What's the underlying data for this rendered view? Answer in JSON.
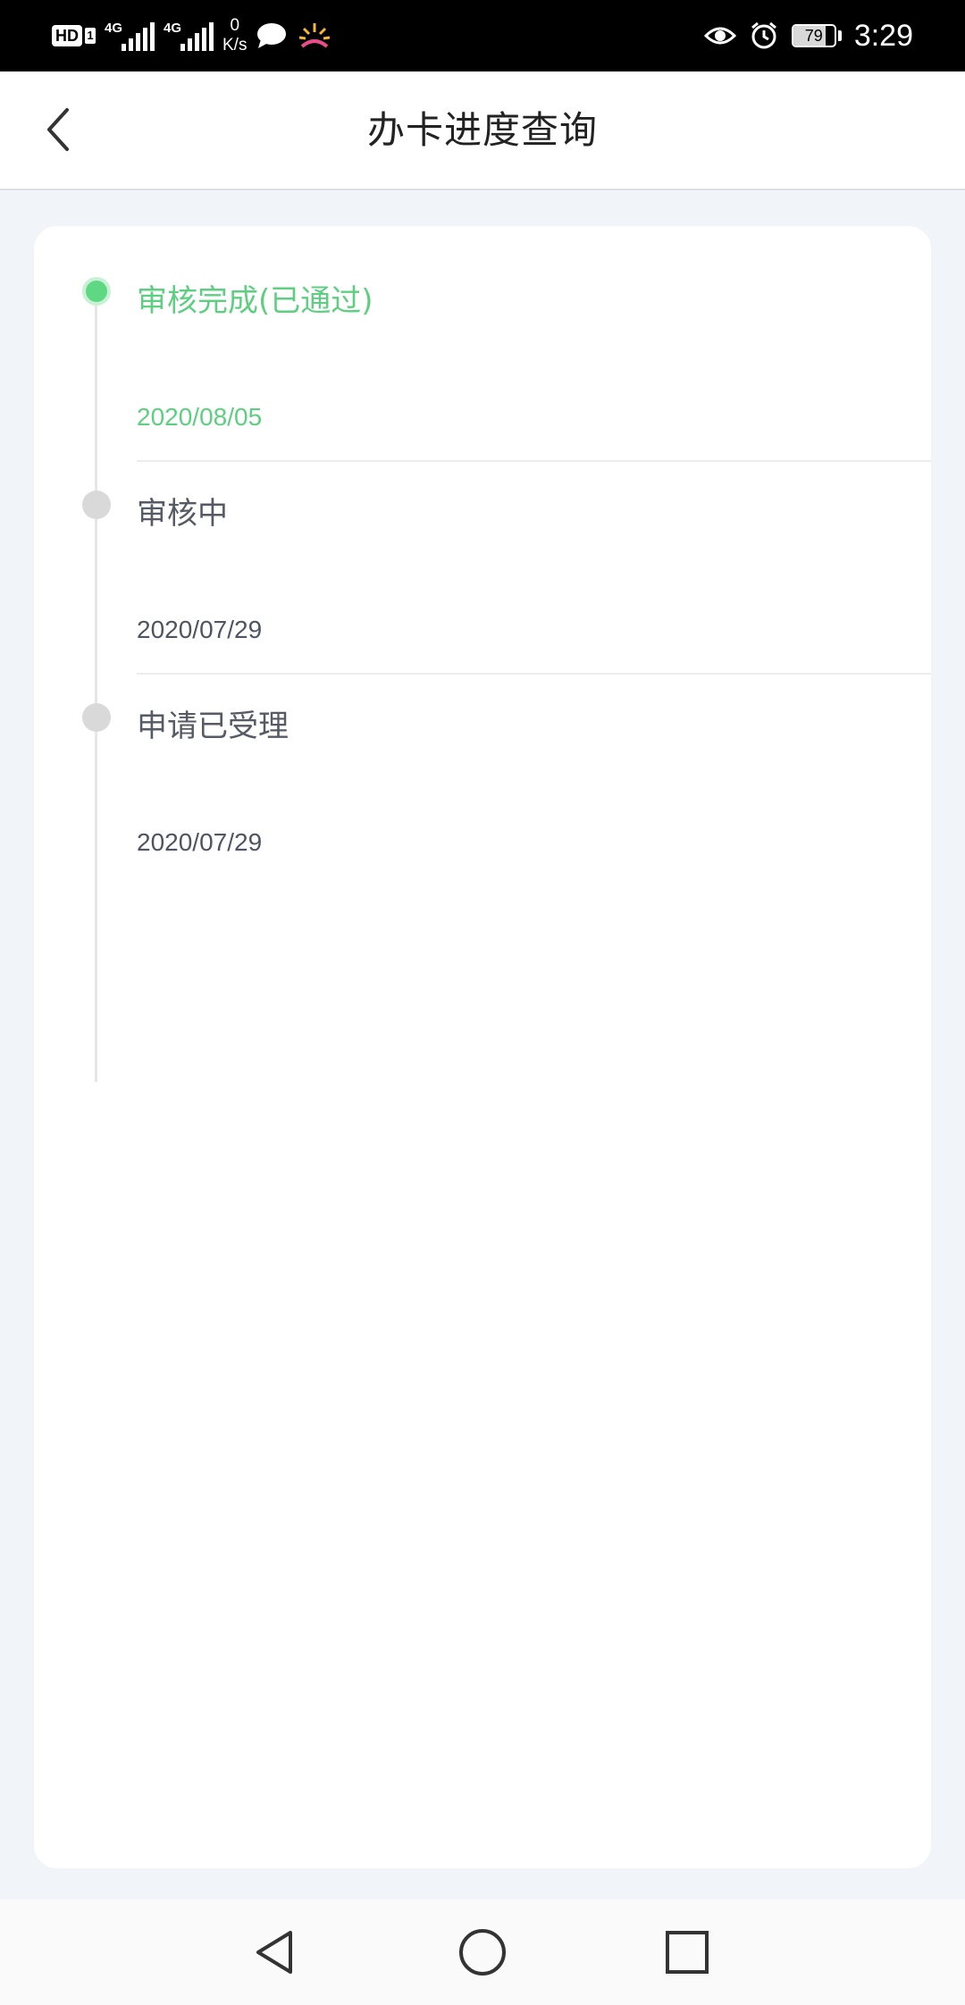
{
  "status_bar": {
    "hd_label": "HD",
    "sim_number": "1",
    "signal1_label": "4G",
    "signal2_label": "4G",
    "net_speed_value": "0",
    "net_speed_unit": "K/s",
    "battery_level": "79",
    "time": "3:29"
  },
  "header": {
    "title": "办卡进度查询"
  },
  "timeline": {
    "steps": [
      {
        "status": "审核完成(已通过)",
        "date": "2020/08/05",
        "state": "active"
      },
      {
        "status": "审核中",
        "date": "2020/07/29",
        "state": "inactive"
      },
      {
        "status": "申请已受理",
        "date": "2020/07/29",
        "state": "inactive"
      }
    ]
  },
  "colors": {
    "accent_green": "#5ecf80",
    "inactive_dot": "#d9d9d9",
    "page_background": "#f1f4f8"
  },
  "icons": {
    "back": "chevron-left-icon",
    "nav_back": "triangle-back-icon",
    "nav_home": "circle-home-icon",
    "nav_recents": "square-recents-icon"
  }
}
